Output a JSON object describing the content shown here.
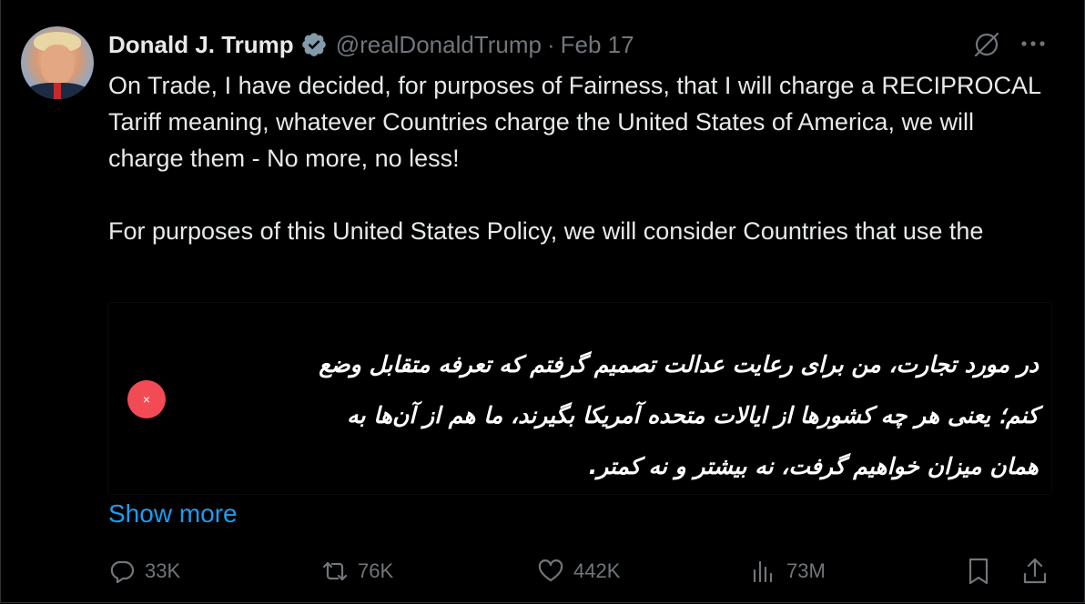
{
  "author": {
    "name": "Donald J. Trump",
    "handle": "@realDonaldTrump",
    "separator": "·",
    "date": "Feb 17",
    "verified_color": "#829aab"
  },
  "tweet": {
    "text": "On Trade, I have decided, for purposes of Fairness, that I will charge a RECIPROCAL Tariff meaning, whatever Countries charge the United States of America, we will charge them - No more, no less!\n\nFor purposes of this United States Policy, we will consider Countries that use the",
    "show_more_label": "Show more"
  },
  "media": {
    "persian_text": "در مورد تجارت، من برای رعایت عدالت تصمیم گرفتم که تعرفه متقابل وضع کنم؛ یعنی هر چه کشورها از ایالات متحده آمریکا بگیرند، ما هم از آن‌ها به همان میزان خواهیم گرفت، نه بیشتر و نه کمتر.",
    "close_glyph": "×",
    "close_color": "#f24b55"
  },
  "actions": {
    "replies": "33K",
    "reposts": "76K",
    "likes": "442K",
    "views": "73M"
  },
  "icons": {
    "grok": "grok-icon",
    "more": "more-icon",
    "reply": "reply-icon",
    "repost": "repost-icon",
    "like": "heart-icon",
    "views": "views-icon",
    "bookmark": "bookmark-icon",
    "share": "share-icon"
  },
  "colors": {
    "background": "#000000",
    "text": "#e7e9ea",
    "muted": "#71767b",
    "link": "#1d9bf0"
  }
}
